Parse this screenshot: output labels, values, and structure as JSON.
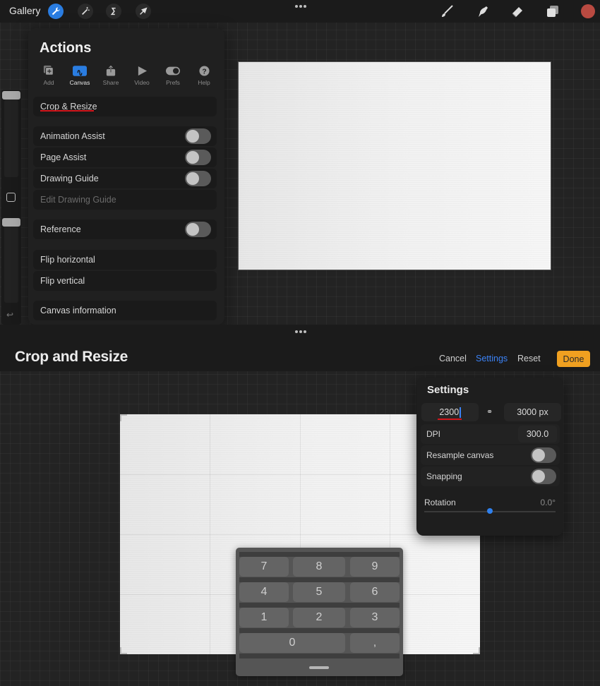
{
  "topbar": {
    "gallery_label": "Gallery",
    "left_tools": [
      {
        "name": "actions",
        "icon": "wrench-icon",
        "active": true
      },
      {
        "name": "adjustments",
        "icon": "magic-wand-icon",
        "active": false
      },
      {
        "name": "selection",
        "icon": "selection-s-icon",
        "active": false
      },
      {
        "name": "transform",
        "icon": "arrow-cursor-icon",
        "active": false
      }
    ],
    "right_tools": [
      {
        "name": "brush",
        "icon": "brush-icon"
      },
      {
        "name": "smudge",
        "icon": "smudge-icon"
      },
      {
        "name": "eraser",
        "icon": "eraser-icon"
      },
      {
        "name": "layers",
        "icon": "layers-icon"
      }
    ],
    "current_color": "#b94a41"
  },
  "actions_panel": {
    "title": "Actions",
    "tabs": [
      {
        "label": "Add",
        "icon": "add-icon",
        "active": false
      },
      {
        "label": "Canvas",
        "icon": "canvas-icon",
        "active": true
      },
      {
        "label": "Share",
        "icon": "share-icon",
        "active": false
      },
      {
        "label": "Video",
        "icon": "play-icon",
        "active": false
      },
      {
        "label": "Prefs",
        "icon": "toggle-icon",
        "active": false
      },
      {
        "label": "Help",
        "icon": "help-icon",
        "active": false
      }
    ],
    "items": {
      "crop_resize": "Crop & Resize",
      "animation_assist": {
        "label": "Animation Assist",
        "on": false
      },
      "page_assist": {
        "label": "Page Assist",
        "on": false
      },
      "drawing_guide": {
        "label": "Drawing Guide",
        "on": false
      },
      "edit_drawing_guide": {
        "label": "Edit Drawing Guide",
        "disabled": true
      },
      "reference": {
        "label": "Reference",
        "on": false
      },
      "flip_horizontal": "Flip horizontal",
      "flip_vertical": "Flip vertical",
      "canvas_information": "Canvas information"
    }
  },
  "crop_resize": {
    "title": "Crop and Resize",
    "cancel_label": "Cancel",
    "settings_label": "Settings",
    "reset_label": "Reset",
    "done_label": "Done",
    "accent_color": "#3b82f6",
    "done_color": "#f0a020"
  },
  "settings_panel": {
    "title": "Settings",
    "width_value": "2300",
    "height_value": "3000 px",
    "dpi_label": "DPI",
    "dpi_value": "300.0",
    "resample_label": "Resample canvas",
    "resample_on": false,
    "snapping_label": "Snapping",
    "snapping_on": false,
    "rotation_label": "Rotation",
    "rotation_value": "0.0°",
    "rotation_fraction": 0.5
  },
  "keypad": {
    "keys": [
      "7",
      "8",
      "9",
      "4",
      "5",
      "6",
      "1",
      "2",
      "3",
      "0",
      ","
    ]
  }
}
